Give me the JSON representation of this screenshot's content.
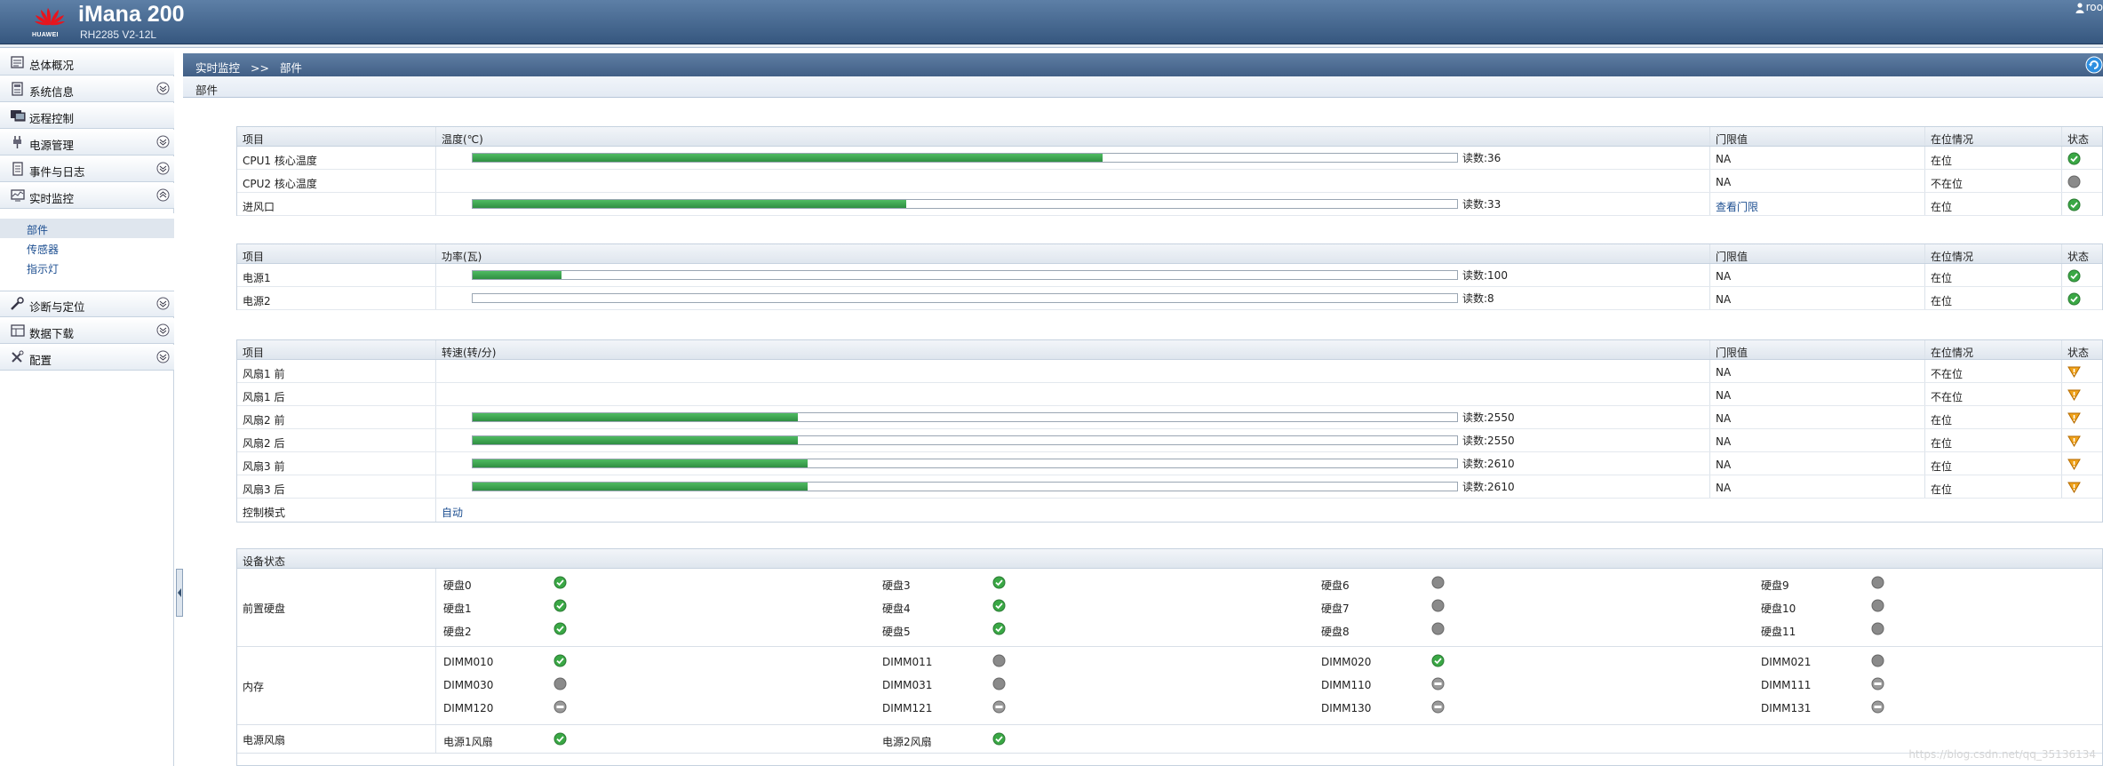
{
  "header": {
    "logo_text": "HUAWEI",
    "product": "iMana 200",
    "model": "RH2285 V2-12L",
    "user": "roo"
  },
  "sidebar": {
    "items": [
      {
        "label": "总体概况",
        "icon": "overview-icon"
      },
      {
        "label": "系统信息",
        "icon": "system-info-icon"
      },
      {
        "label": "远程控制",
        "icon": "remote-control-icon"
      },
      {
        "label": "电源管理",
        "icon": "power-management-icon"
      },
      {
        "label": "事件与日志",
        "icon": "event-log-icon"
      },
      {
        "label": "实时监控",
        "icon": "realtime-monitor-icon"
      },
      {
        "label": "诊断与定位",
        "icon": "diagnosis-icon"
      },
      {
        "label": "数据下载",
        "icon": "data-download-icon"
      },
      {
        "label": "配置",
        "icon": "config-icon"
      }
    ],
    "subitems": [
      "部件",
      "传感器",
      "指示灯"
    ]
  },
  "page": {
    "crumb_parent": "实时监控",
    "crumb_sep": ">>",
    "crumb_current": "部件",
    "section_title": "部件"
  },
  "colors": {
    "ok": "#3aa845",
    "absent": "#8a8a8a",
    "warn": "#f0a21a",
    "bar": "#37a24b"
  },
  "temperature": {
    "headers": [
      "项目",
      "温度(℃)",
      "门限值",
      "在位情况",
      "状态"
    ],
    "rows": [
      {
        "name": "CPU1 核心温度",
        "bar": true,
        "fill": 0.64,
        "reading": "读数:36",
        "threshold": "NA",
        "presence": "在位",
        "status": "ok"
      },
      {
        "name": "CPU2 核心温度",
        "bar": false,
        "reading": "",
        "threshold": "NA",
        "presence": "不在位",
        "status": "absent"
      },
      {
        "name": "进风口",
        "bar": true,
        "fill": 0.44,
        "reading": "读数:33",
        "threshold": "查看门限",
        "threshold_link": true,
        "presence": "在位",
        "status": "ok"
      }
    ]
  },
  "power": {
    "headers": [
      "项目",
      "功率(瓦)",
      "门限值",
      "在位情况",
      "状态"
    ],
    "rows": [
      {
        "name": "电源1",
        "bar": true,
        "fill": 0.09,
        "reading": "读数:100",
        "threshold": "NA",
        "presence": "在位",
        "status": "ok"
      },
      {
        "name": "电源2",
        "bar": true,
        "fill": 0.0,
        "reading": "读数:8",
        "threshold": "NA",
        "presence": "在位",
        "status": "ok"
      }
    ]
  },
  "fan": {
    "headers": [
      "项目",
      "转速(转/分)",
      "门限值",
      "在位情况",
      "状态"
    ],
    "rows": [
      {
        "name": "风扇1 前",
        "bar": false,
        "reading": "",
        "threshold": "NA",
        "presence": "不在位",
        "status": "warn"
      },
      {
        "name": "风扇1 后",
        "bar": false,
        "reading": "",
        "threshold": "NA",
        "presence": "不在位",
        "status": "warn"
      },
      {
        "name": "风扇2 前",
        "bar": true,
        "fill": 0.33,
        "reading": "读数:2550",
        "threshold": "NA",
        "presence": "在位",
        "status": "warn"
      },
      {
        "name": "风扇2 后",
        "bar": true,
        "fill": 0.33,
        "reading": "读数:2550",
        "threshold": "NA",
        "presence": "在位",
        "status": "warn"
      },
      {
        "name": "风扇3 前",
        "bar": true,
        "fill": 0.34,
        "reading": "读数:2610",
        "threshold": "NA",
        "presence": "在位",
        "status": "warn"
      },
      {
        "name": "风扇3 后",
        "bar": true,
        "fill": 0.34,
        "reading": "读数:2610",
        "threshold": "NA",
        "presence": "在位",
        "status": "warn"
      }
    ],
    "control_label": "控制模式",
    "control_value": "自动"
  },
  "devices": {
    "title": "设备状态",
    "groups": [
      {
        "label": "前置硬盘",
        "items": [
          [
            "硬盘0",
            "ok"
          ],
          [
            "硬盘3",
            "ok"
          ],
          [
            "硬盘6",
            "absent"
          ],
          [
            "硬盘9",
            "absent"
          ],
          [
            "硬盘1",
            "ok"
          ],
          [
            "硬盘4",
            "ok"
          ],
          [
            "硬盘7",
            "absent"
          ],
          [
            "硬盘10",
            "absent"
          ],
          [
            "硬盘2",
            "ok"
          ],
          [
            "硬盘5",
            "ok"
          ],
          [
            "硬盘8",
            "absent"
          ],
          [
            "硬盘11",
            "absent"
          ]
        ]
      },
      {
        "label": "内存",
        "items": [
          [
            "DIMM010",
            "ok"
          ],
          [
            "DIMM011",
            "absent"
          ],
          [
            "DIMM020",
            "ok"
          ],
          [
            "DIMM021",
            "absent"
          ],
          [
            "DIMM030",
            "absent"
          ],
          [
            "DIMM031",
            "absent"
          ],
          [
            "DIMM110",
            "disabled"
          ],
          [
            "DIMM111",
            "disabled"
          ],
          [
            "DIMM120",
            "disabled"
          ],
          [
            "DIMM121",
            "disabled"
          ],
          [
            "DIMM130",
            "disabled"
          ],
          [
            "DIMM131",
            "disabled"
          ]
        ]
      },
      {
        "label": "电源风扇",
        "items": [
          [
            "电源1风扇",
            "ok"
          ],
          [
            "电源2风扇",
            "ok"
          ]
        ]
      }
    ]
  },
  "watermark": "https://blog.csdn.net/qq_35136134"
}
